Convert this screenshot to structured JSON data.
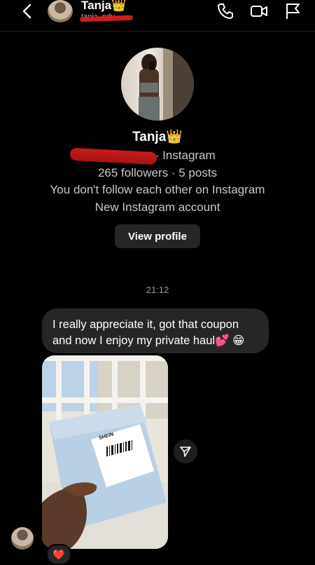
{
  "header": {
    "contact_name": "Tanja👑",
    "contact_username": "tanja_ndu"
  },
  "profile": {
    "name": "Tanja👑",
    "source_suffix": "· Instagram",
    "stats": "265 followers · 5 posts",
    "follow_status": "You don't follow each other on Instagram",
    "account_note": "New Instagram account",
    "view_profile_label": "View profile"
  },
  "conversation": {
    "timestamp": "21:12",
    "message_text": "I really appreciate it, got that coupon and now I enjoy my private haul💕 😁",
    "photo_label_text": "SHEIN",
    "reaction": "❤️"
  },
  "icons": {
    "back": "chevron-left-icon",
    "call": "phone-icon",
    "video": "video-camera-icon",
    "report": "flag-icon",
    "share": "send-icon"
  }
}
